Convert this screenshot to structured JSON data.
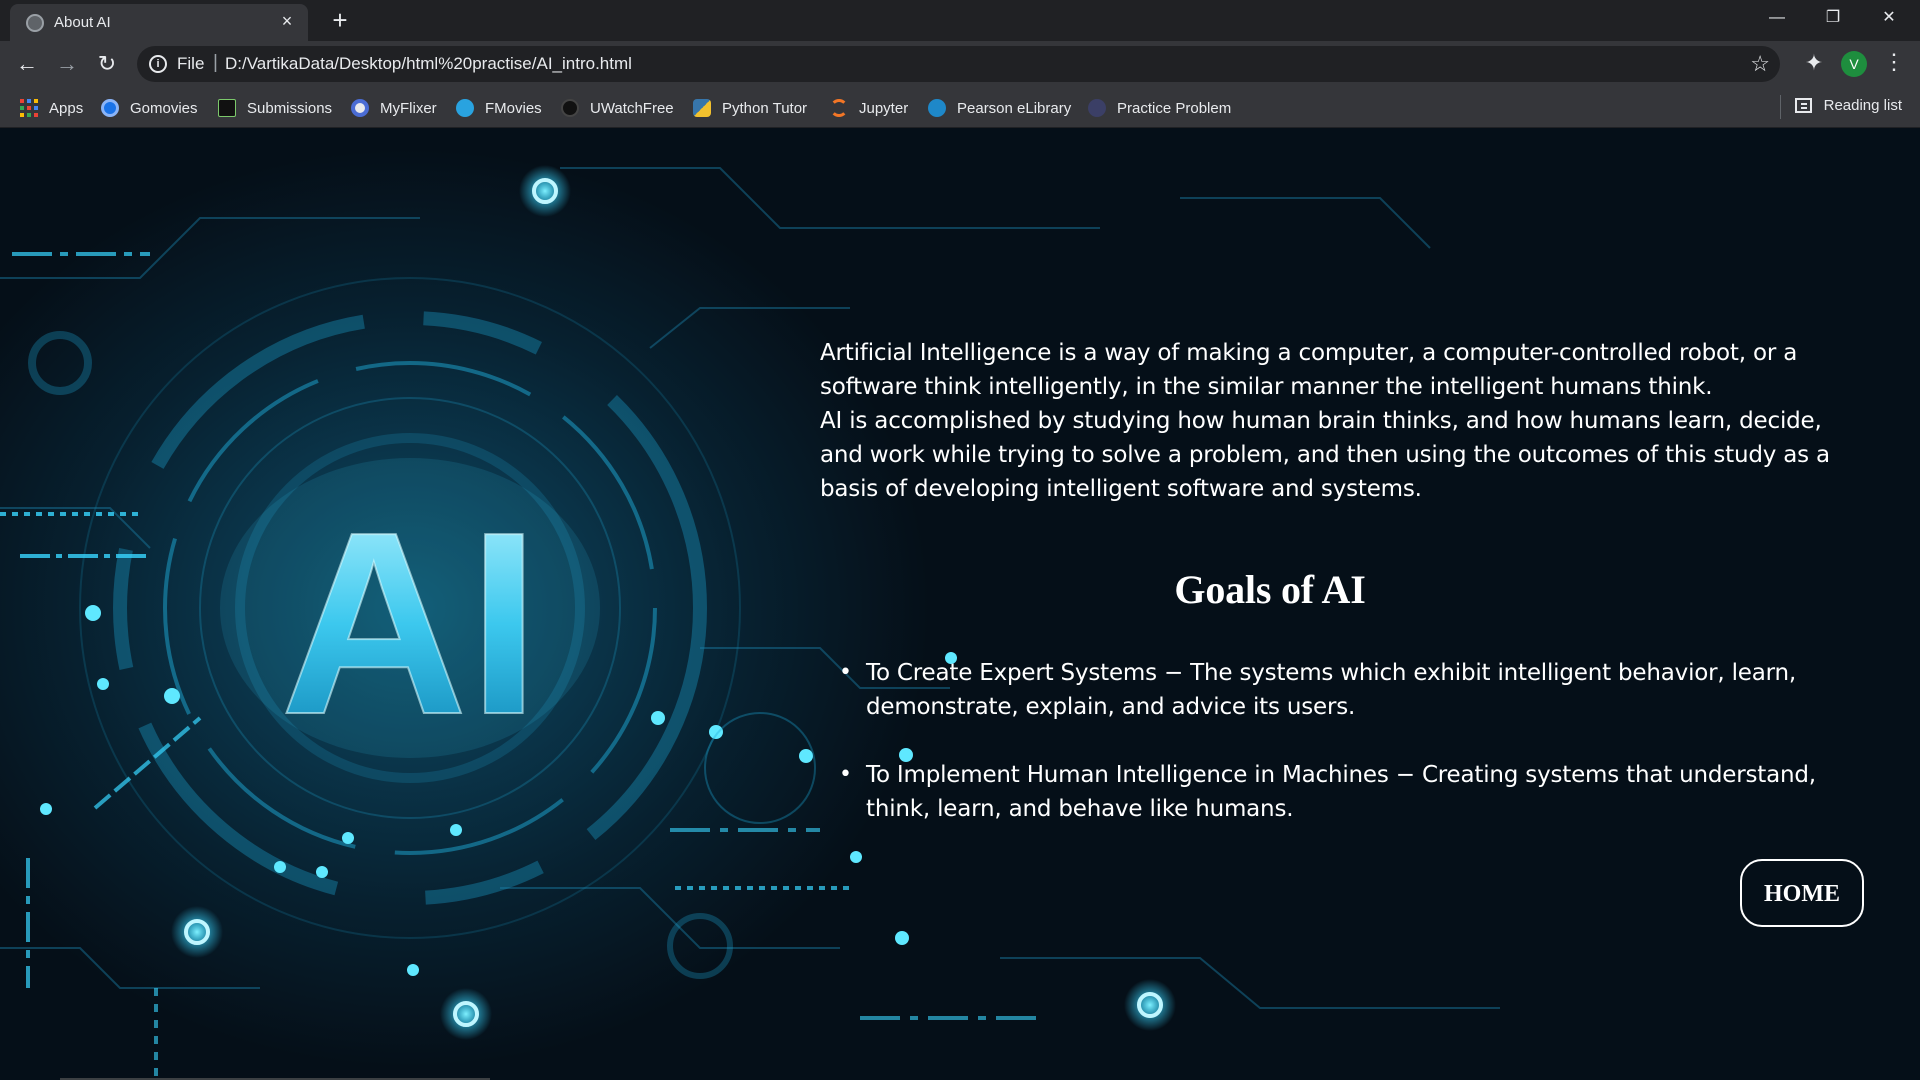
{
  "tab": {
    "title": "About AI",
    "close_icon": "×",
    "new_tab_icon": "+"
  },
  "window_controls": {
    "minimize": "—",
    "restore": "❐",
    "close": "✕"
  },
  "toolbar": {
    "back": "←",
    "forward": "→",
    "reload": "↻",
    "info_icon": "i",
    "scheme": "File",
    "separator": "|",
    "url": "D:/VartikaData/Desktop/html%20practise/AI_intro.html",
    "star": "☆",
    "extensions": "✦",
    "avatar_letter": "V",
    "menu": "⋮"
  },
  "bookmarks": [
    {
      "label": "Apps",
      "icon": "apps-grid-icon"
    },
    {
      "label": "Gomovies",
      "icon": "gomovies-icon",
      "color": "#1a73e8"
    },
    {
      "label": "Submissions",
      "icon": "submissions-icon",
      "color": "#111111"
    },
    {
      "label": "MyFlixer",
      "icon": "myflixer-icon",
      "color": "#4a6cd4"
    },
    {
      "label": "FMovies",
      "icon": "fmovies-icon",
      "color": "#29a3e0"
    },
    {
      "label": "UWatchFree",
      "icon": "uwatchfree-icon",
      "color": "#111111"
    },
    {
      "label": "Python Tutor",
      "icon": "python-icon",
      "color": "#f2c12e"
    },
    {
      "label": "Jupyter",
      "icon": "jupyter-icon",
      "color": "#f37626"
    },
    {
      "label": "Pearson eLibrary",
      "icon": "pearson-icon",
      "color": "#1e88c9"
    },
    {
      "label": "Practice Problem",
      "icon": "practice-icon",
      "color": "#3b3f66"
    }
  ],
  "reading_list": "Reading list",
  "page": {
    "intro_p1": "Artificial Intelligence is a way of making a computer, a computer-controlled robot, or a software think intelligently, in the similar manner the intelligent humans think.",
    "intro_p2": "AI is accomplished by studying how human brain thinks, and how humans learn, decide, and work while trying to solve a problem, and then using the outcomes of this study as a basis of developing intelligent software and systems.",
    "goals_heading": "Goals of AI",
    "goals": [
      "To Create Expert Systems − The systems which exhibit intelligent behavior, learn, demonstrate, explain, and advice its users.",
      "To Implement Human Intelligence in Machines − Creating systems that understand, think, learn, and behave like humans."
    ],
    "home_button": "HOME",
    "hero_text": "AI"
  },
  "colors": {
    "accent_cyan": "#38d6ff",
    "chrome_dark": "#202124",
    "chrome_mid": "#35363a"
  }
}
